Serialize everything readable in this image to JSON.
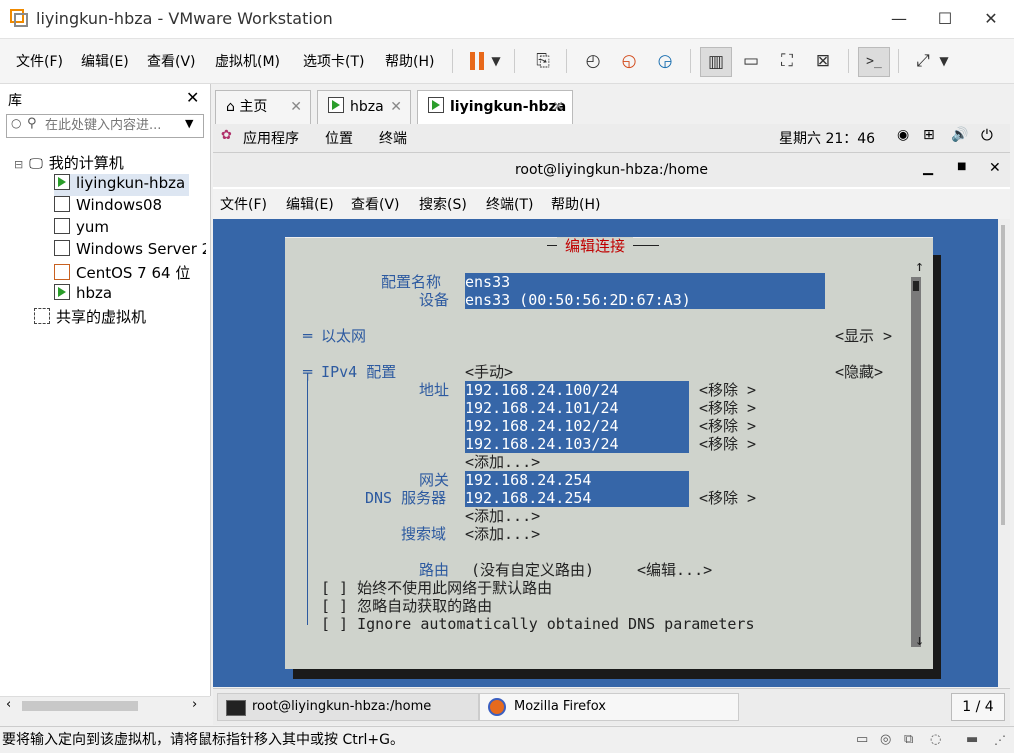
{
  "window": {
    "title": "liyingkun-hbza - VMware Workstation"
  },
  "menubar": [
    "文件(F)",
    "编辑(E)",
    "查看(V)",
    "虚拟机(M)",
    "选项卡(T)",
    "帮助(H)"
  ],
  "library": {
    "title": "库",
    "search_placeholder": "在此处键入内容进...",
    "root": "我的计算机",
    "vms": [
      {
        "name": "liyingkun-hbza",
        "running": true,
        "selected": true
      },
      {
        "name": "Windows08",
        "running": false
      },
      {
        "name": "yum",
        "running": false
      },
      {
        "name": "Windows Server 2",
        "running": false
      },
      {
        "name": "CentOS 7 64 位",
        "running": false
      },
      {
        "name": "hbza",
        "running": true
      }
    ],
    "shared": "共享的虚拟机"
  },
  "tabs": [
    {
      "label": "主页"
    },
    {
      "label": "hbza"
    },
    {
      "label": "liyingkun-hbza",
      "active": true
    }
  ],
  "gnome": {
    "applications": "应用程序",
    "places": "位置",
    "terminal": "终端",
    "clock": "星期六 21：46"
  },
  "terminal": {
    "title": "root@liyingkun-hbza:/home",
    "menu": [
      "文件(F)",
      "编辑(E)",
      "查看(V)",
      "搜索(S)",
      "终端(T)",
      "帮助(H)"
    ]
  },
  "dialog": {
    "title": "编辑连接",
    "profile_label": "配置名称",
    "profile_value": "ens33",
    "device_label": "设备",
    "device_value": "ens33 (00:50:56:2D:67:A3)",
    "ethernet_label": "═ 以太网",
    "ethernet_action": "<显示 >",
    "ipv4_label": "╤ IPv4 配置",
    "ipv4_mode": "<手动>",
    "ipv4_action": "<隐藏>",
    "address_label": "地址",
    "addresses": [
      "192.168.24.100/24",
      "192.168.24.101/24",
      "192.168.24.102/24",
      "192.168.24.103/24"
    ],
    "remove": "<移除 >",
    "add": "<添加...>",
    "gateway_label": "网关",
    "gateway_value": "192.168.24.254",
    "dns_label": "DNS 服务器",
    "dns_value": "192.168.24.254",
    "search_label": "搜索域",
    "routing_label": "路由",
    "routing_value": "(没有自定义路由)",
    "routing_edit": "<编辑...>",
    "checks": [
      "[ ] 始终不使用此网络于默认路由",
      "[ ] 忽略自动获取的路由",
      "[ ] Ignore automatically obtained DNS parameters"
    ],
    "scroll_up": "↑",
    "scroll_down": "↓"
  },
  "vm_taskbar": {
    "items": [
      "root@liyingkun-hbza:/home",
      "Mozilla Firefox"
    ],
    "pager": "1 / 4"
  },
  "status": {
    "text": "要将输入定向到该虚拟机，请将鼠标指针移入其中或按 Ctrl+G。"
  }
}
